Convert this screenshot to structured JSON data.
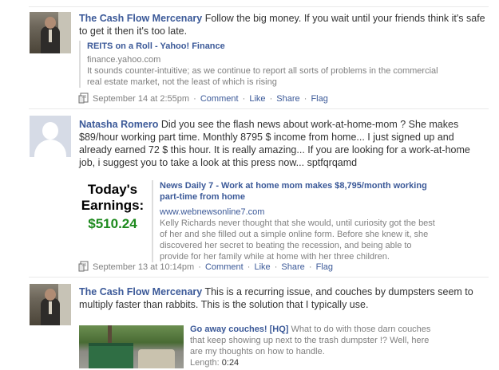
{
  "posts": [
    {
      "author": "The Cash Flow Mercenary",
      "message": " Follow the big money. If you wait until your friends think it's safe to get it then it's too late.",
      "attachment": {
        "title": "REITS on a Roll - Yahoo! Finance",
        "source": "finance.yahoo.com",
        "description": "It sounds counter-intuitive; as we continue to report all sorts of problems in the commercial real estate market, not the least of which is rising"
      },
      "time": "September 14 at 2:55pm",
      "actions": {
        "comment": "Comment",
        "like": "Like",
        "share": "Share",
        "flag": "Flag"
      }
    },
    {
      "author": "Natasha Romero",
      "message": " Did you see the flash news about work-at-home-mom ? She makes $89/hour working part time. Monthly 8795 $ income from home... I just signed up and already earned 72 $ this hour. It is really amazing... If you are looking for a work-at-home job, i suggest you to take a look at this press now... sptfqrqamd",
      "thumb": {
        "line1": "Today's",
        "line2": "Earnings:",
        "line3": "$510.24"
      },
      "attachment": {
        "title": "News Daily 7 - Work at home mom makes $8,795/month working part-time from home",
        "source": "www.webnewsonline7.com",
        "description": "Kelly Richards never thought that she would, until curiosity got the best of her and she filled out a simple online form. Before she knew it, she discovered her secret to beating the recession, and being able to provide for her family while at home with her three children."
      },
      "time": "September 13 at 10:14pm",
      "actions": {
        "comment": "Comment",
        "like": "Like",
        "share": "Share",
        "flag": "Flag"
      }
    },
    {
      "author": "The Cash Flow Mercenary",
      "message": " This is a recurring issue, and couches by dumpsters seem to multiply faster than rabbits. This is the solution that I typically use.",
      "attachment": {
        "title": "Go away couches! [HQ]",
        "description": " What to do with those darn couches that keep showing up next to the trash dumpster !? Well, here are my thoughts on how to handle.",
        "length_label": "Length:",
        "length_value": "0:24"
      }
    }
  ],
  "colors": {
    "link": "#3b5998",
    "muted": "#808080",
    "text": "#333333",
    "earnings_green": "#1e8a1e"
  }
}
